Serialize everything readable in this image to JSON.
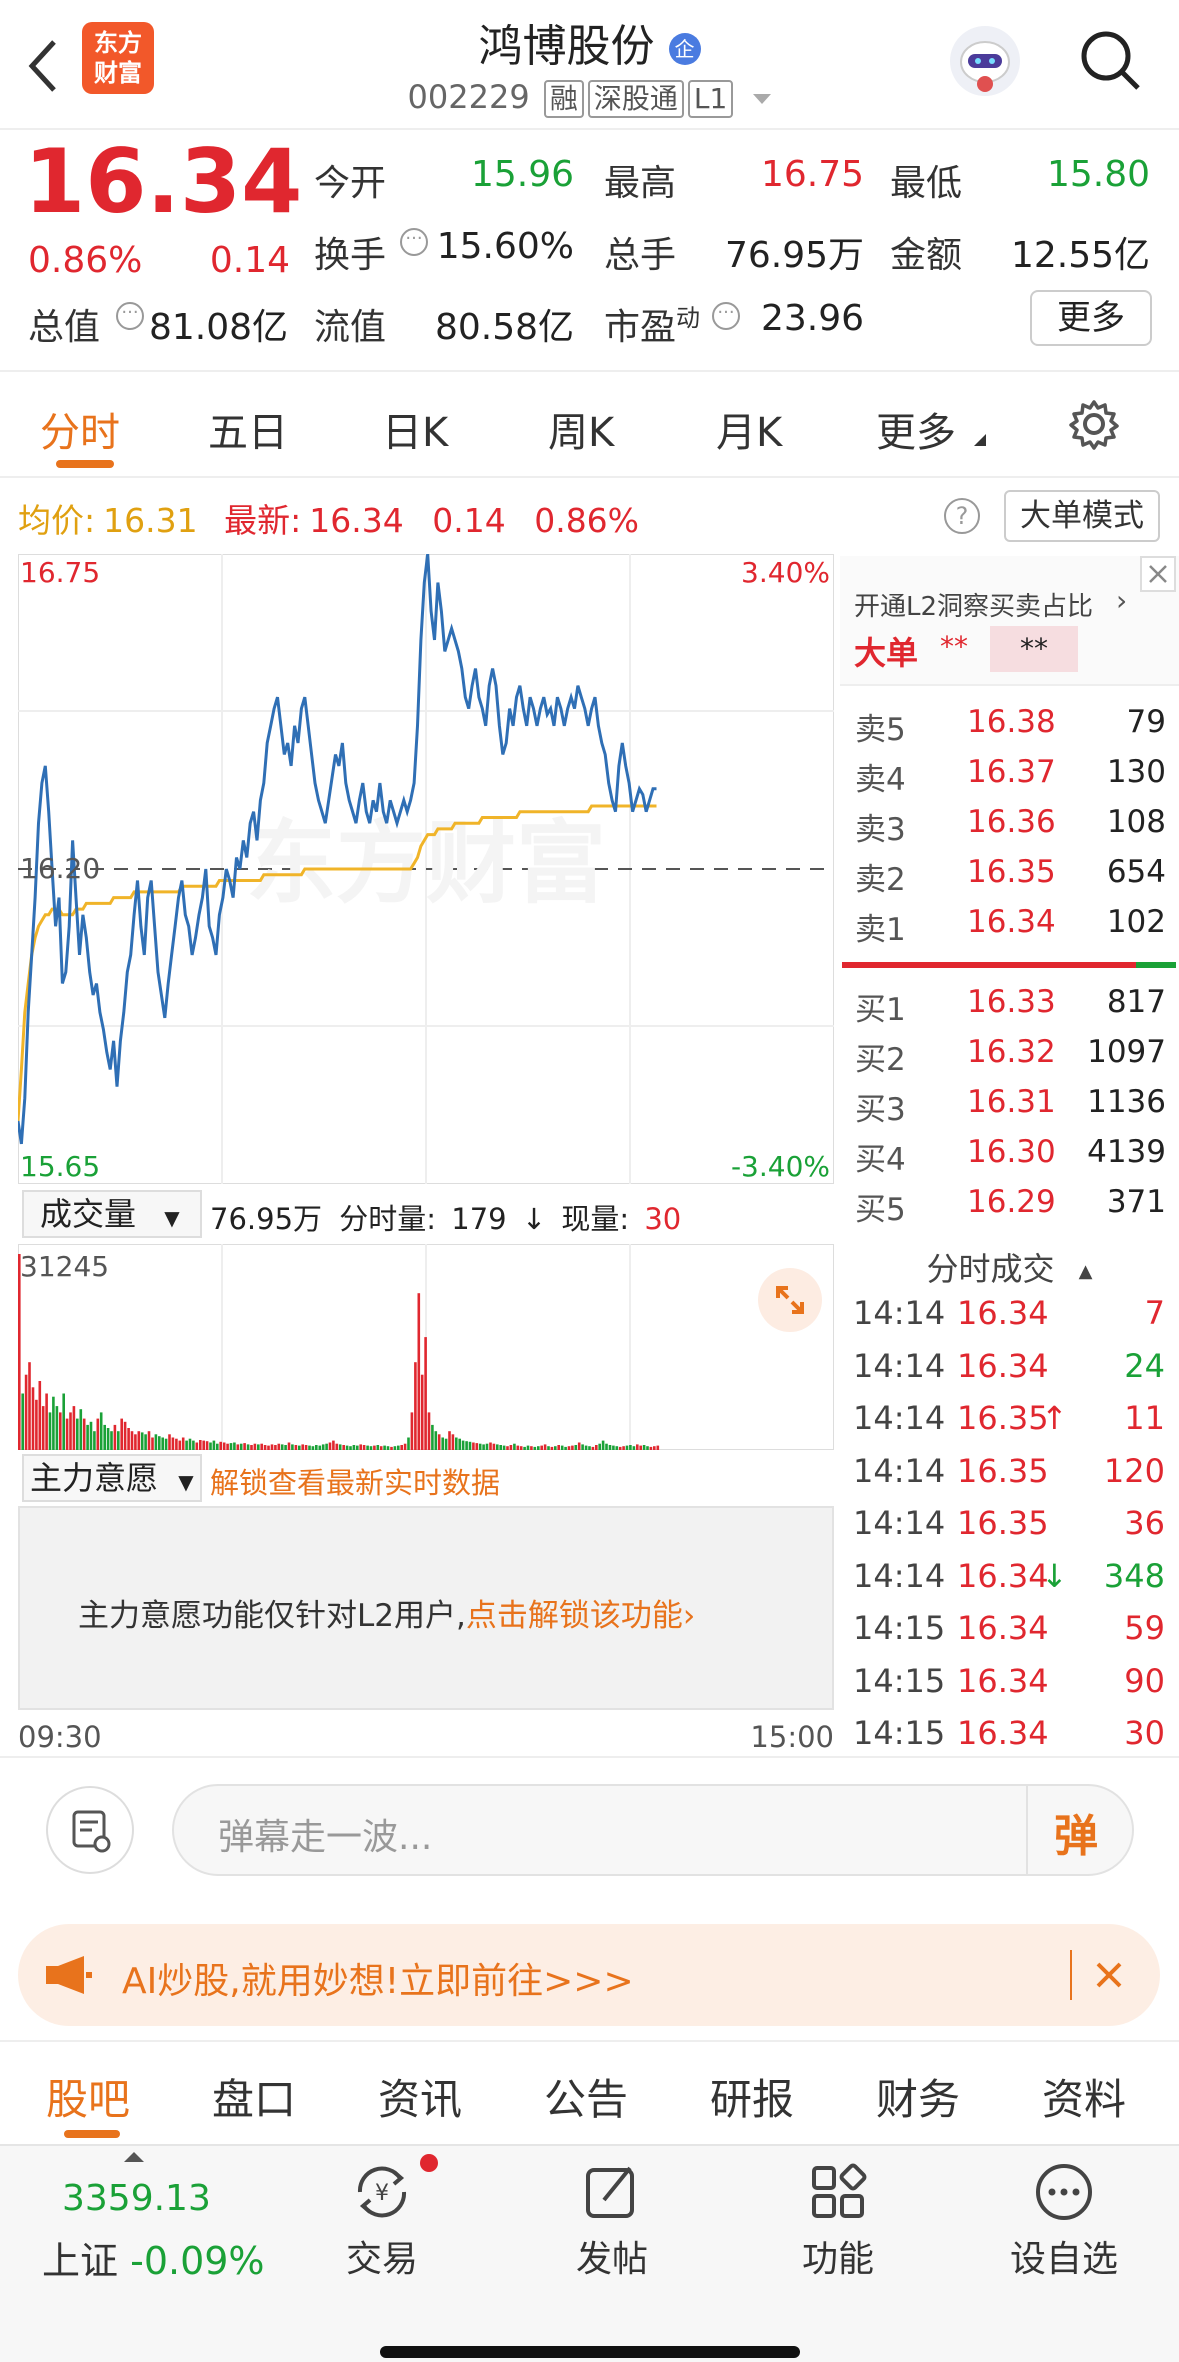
{
  "header": {
    "title": "鸿博股份",
    "code": "002229",
    "tags": [
      "融",
      "深股通",
      "L1"
    ],
    "logo_line1": "东方",
    "logo_line2": "财富",
    "badge": "企"
  },
  "quote": {
    "price": "16.34",
    "pct": "0.86%",
    "chg": "0.14",
    "fields": [
      {
        "label": "今开",
        "value": "15.96",
        "color": "green"
      },
      {
        "label": "最高",
        "value": "16.75",
        "color": "red"
      },
      {
        "label": "最低",
        "value": "15.80",
        "color": "green"
      },
      {
        "label": "换手",
        "value": "15.60%",
        "color": "black"
      },
      {
        "label": "总手",
        "value": "76.95万",
        "color": "black"
      },
      {
        "label": "金额",
        "value": "12.55亿",
        "color": "black"
      },
      {
        "label": "总值",
        "value": "81.08亿",
        "color": "black"
      },
      {
        "label": "流值",
        "value": "80.58亿",
        "color": "black"
      },
      {
        "label": "市盈",
        "sup": "动",
        "value": "23.96",
        "color": "black"
      }
    ],
    "more_btn": "更多"
  },
  "tabs": [
    "分时",
    "五日",
    "日K",
    "周K",
    "月K",
    "更多"
  ],
  "info_bar": {
    "avg_label": "均价:",
    "avg": "16.31",
    "latest_label": "最新:",
    "latest": "16.34",
    "chg": "0.14",
    "pct": "0.86%",
    "mode_btn": "大单模式"
  },
  "chart": {
    "high": "16.75",
    "low": "15.65",
    "mid": "16.20",
    "pct_high": "3.40%",
    "pct_low": "-3.40%",
    "watermark": "东方财富",
    "time_start": "09:30",
    "time_end": "15:00"
  },
  "chart_data": {
    "type": "line",
    "title": "",
    "ylim": [
      15.65,
      16.75
    ],
    "series": [
      {
        "name": "",
        "values": [
          15.76,
          15.72,
          15.8,
          15.95,
          16.05,
          16.15,
          16.28,
          16.35,
          16.38,
          16.3,
          16.2,
          16.1,
          16.15,
          16.0,
          16.02,
          16.1,
          16.25,
          16.15,
          16.05,
          16.12,
          16.08,
          16.02,
          15.98,
          16.0,
          15.95,
          15.92,
          15.88,
          15.85,
          15.9,
          15.82,
          15.9,
          15.95,
          16.02,
          16.05,
          16.12,
          16.18,
          16.1,
          16.05,
          16.15,
          16.18,
          16.1,
          16.02,
          15.98,
          15.94,
          16.0,
          16.05,
          16.1,
          16.15,
          16.18,
          16.12,
          16.1,
          16.05,
          16.08,
          16.12,
          16.15,
          16.2,
          16.1,
          16.08,
          16.05,
          16.12,
          16.15,
          16.2,
          16.18,
          16.15,
          16.22,
          16.2,
          16.25,
          16.22,
          16.28,
          16.3,
          16.25,
          16.32,
          16.35,
          16.42,
          16.45,
          16.48,
          16.5,
          16.45,
          16.4,
          16.42,
          16.38,
          16.45,
          16.42,
          16.48,
          16.5,
          16.45,
          16.4,
          16.35,
          16.32,
          16.3,
          16.28,
          16.32,
          16.36,
          16.4,
          16.38,
          16.42,
          16.35,
          16.32,
          16.3,
          16.28,
          16.32,
          16.35,
          16.3,
          16.28,
          16.32,
          16.3,
          16.35,
          16.3,
          16.28,
          16.32,
          16.3,
          16.28,
          16.3,
          16.32,
          16.3,
          16.32,
          16.35,
          16.45,
          16.6,
          16.7,
          16.75,
          16.65,
          16.6,
          16.7,
          16.65,
          16.58,
          16.6,
          16.62,
          16.6,
          16.58,
          16.55,
          16.5,
          16.48,
          16.52,
          16.55,
          16.5,
          16.48,
          16.45,
          16.52,
          16.55,
          16.52,
          16.45,
          16.4,
          16.42,
          16.48,
          16.45,
          16.5,
          16.52,
          16.48,
          16.45,
          16.5,
          16.48,
          16.45,
          16.48,
          16.5,
          16.47,
          16.48,
          16.45,
          16.5,
          16.48,
          16.45,
          16.48,
          16.5,
          16.48,
          16.52,
          16.5,
          16.48,
          16.45,
          16.48,
          16.5,
          16.45,
          16.42,
          16.4,
          16.35,
          16.32,
          16.3,
          16.38,
          16.42,
          16.38,
          16.35,
          16.3,
          16.32,
          16.34,
          16.33,
          16.3,
          16.32,
          16.34,
          16.34
        ]
      },
      {
        "name": "",
        "values": [
          15.76,
          15.85,
          15.95,
          16.0,
          16.05,
          16.08,
          16.1,
          16.11,
          16.12,
          16.12,
          16.13,
          16.13,
          16.13,
          16.12,
          16.12,
          16.12,
          16.12,
          16.13,
          16.13,
          16.13,
          16.14,
          16.14,
          16.14,
          16.14,
          16.14,
          16.14,
          16.14,
          16.14,
          16.15,
          16.15,
          16.15,
          16.15,
          16.15,
          16.15,
          16.16,
          16.16,
          16.16,
          16.16,
          16.16,
          16.16,
          16.16,
          16.16,
          16.16,
          16.16,
          16.16,
          16.16,
          16.16,
          16.16,
          16.17,
          16.17,
          16.17,
          16.17,
          16.17,
          16.17,
          16.17,
          16.17,
          16.17,
          16.17,
          16.17,
          16.18,
          16.18,
          16.18,
          16.18,
          16.18,
          16.18,
          16.18,
          16.18,
          16.18,
          16.18,
          16.18,
          16.18,
          16.18,
          16.19,
          16.19,
          16.19,
          16.19,
          16.19,
          16.19,
          16.19,
          16.19,
          16.19,
          16.19,
          16.19,
          16.19,
          16.2,
          16.2,
          16.2,
          16.2,
          16.2,
          16.2,
          16.2,
          16.2,
          16.2,
          16.2,
          16.2,
          16.2,
          16.2,
          16.2,
          16.2,
          16.2,
          16.2,
          16.2,
          16.2,
          16.2,
          16.2,
          16.2,
          16.2,
          16.2,
          16.2,
          16.2,
          16.2,
          16.2,
          16.2,
          16.2,
          16.2,
          16.2,
          16.21,
          16.22,
          16.24,
          16.25,
          16.26,
          16.26,
          16.26,
          16.27,
          16.27,
          16.27,
          16.27,
          16.27,
          16.28,
          16.28,
          16.28,
          16.28,
          16.28,
          16.28,
          16.28,
          16.28,
          16.29,
          16.29,
          16.29,
          16.29,
          16.29,
          16.29,
          16.29,
          16.29,
          16.29,
          16.29,
          16.29,
          16.3,
          16.3,
          16.3,
          16.3,
          16.3,
          16.3,
          16.3,
          16.3,
          16.3,
          16.3,
          16.3,
          16.3,
          16.3,
          16.3,
          16.3,
          16.3,
          16.3,
          16.3,
          16.3,
          16.3,
          16.3,
          16.31,
          16.31,
          16.31,
          16.31,
          16.31,
          16.31,
          16.31,
          16.31,
          16.31,
          16.31,
          16.31,
          16.31,
          16.31,
          16.31,
          16.31,
          16.31,
          16.31,
          16.31,
          16.31,
          16.31
        ]
      }
    ],
    "volume": [
      31245,
      9000,
      12000,
      14000,
      10000,
      8000,
      11000,
      7000,
      9000,
      6000,
      8500,
      7000,
      6000,
      9000,
      5000,
      6000,
      7000,
      5000,
      6500,
      5000,
      4000,
      4500,
      3000,
      5000,
      6000,
      4000,
      3500,
      3000,
      4000,
      3000,
      5000,
      4500,
      3500,
      3000,
      2500,
      3000,
      2800,
      2500,
      3000,
      2000,
      2500,
      2200,
      2000,
      1800,
      2500,
      2000,
      1800,
      1500,
      2000,
      1500,
      1800,
      1500,
      1200,
      1600,
      1500,
      1400,
      1200,
      1500,
      1000,
      1300,
      1200,
      1000,
      1100,
      1200,
      900,
      1000,
      1100,
      900,
      800,
      1000,
      900,
      1000,
      800,
      700,
      900,
      800,
      1000,
      900,
      800,
      1200,
      900,
      800,
      700,
      900,
      800,
      700,
      600,
      800,
      700,
      900,
      1000,
      1200,
      1500,
      1000,
      900,
      800,
      700,
      600,
      800,
      700,
      900,
      800,
      700,
      600,
      700,
      800,
      600,
      700,
      600,
      500,
      600,
      700,
      800,
      1000,
      2000,
      6000,
      14000,
      25000,
      12000,
      18000,
      6000,
      4000,
      3000,
      2500,
      2000,
      1800,
      3000,
      2500,
      2000,
      1800,
      1500,
      1400,
      1300,
      1200,
      1100,
      1000,
      900,
      1000,
      1200,
      1000,
      900,
      800,
      700,
      600,
      800,
      1000,
      700,
      600,
      500,
      700,
      600,
      500,
      600,
      700,
      900,
      600,
      500,
      600,
      800,
      700,
      500,
      600,
      700,
      800,
      1200,
      900,
      700,
      600,
      500,
      800,
      1000,
      1500,
      1000,
      800,
      700,
      600,
      500,
      600,
      700,
      800,
      600,
      900,
      700,
      800,
      600,
      500,
      600,
      700
    ]
  },
  "volume_bar": {
    "dropdown": "成交量",
    "total": "76.95万",
    "period_label": "分时量:",
    "period": "179",
    "arrow": "↓",
    "now_label": "现量:",
    "now": "30",
    "max": "31245"
  },
  "main_will": {
    "dropdown": "主力意愿",
    "unlock": "解锁查看最新实时数据",
    "msg": "主力意愿功能仅针对L2用户,",
    "link": "点击解锁该功能"
  },
  "orderbook": {
    "promo": "开通L2洞察买卖占比",
    "big_label": "大单",
    "stars1": "**",
    "stars2": "**",
    "asks": [
      {
        "lbl": "卖5",
        "p": "16.38",
        "v": "79"
      },
      {
        "lbl": "卖4",
        "p": "16.37",
        "v": "130"
      },
      {
        "lbl": "卖3",
        "p": "16.36",
        "v": "108"
      },
      {
        "lbl": "卖2",
        "p": "16.35",
        "v": "654"
      },
      {
        "lbl": "卖1",
        "p": "16.34",
        "v": "102"
      }
    ],
    "bids": [
      {
        "lbl": "买1",
        "p": "16.33",
        "v": "817"
      },
      {
        "lbl": "买2",
        "p": "16.32",
        "v": "1097"
      },
      {
        "lbl": "买3",
        "p": "16.31",
        "v": "1136"
      },
      {
        "lbl": "买4",
        "p": "16.30",
        "v": "4139"
      },
      {
        "lbl": "买5",
        "p": "16.29",
        "v": "371"
      }
    ]
  },
  "trades": {
    "title": "分时成交",
    "rows": [
      {
        "t": "14:14",
        "p": "16.34",
        "a": "",
        "v": "7",
        "c": "red"
      },
      {
        "t": "14:14",
        "p": "16.34",
        "a": "",
        "v": "24",
        "c": "green"
      },
      {
        "t": "14:14",
        "p": "16.35",
        "a": "↑",
        "v": "11",
        "c": "red"
      },
      {
        "t": "14:14",
        "p": "16.35",
        "a": "",
        "v": "120",
        "c": "red"
      },
      {
        "t": "14:14",
        "p": "16.35",
        "a": "",
        "v": "36",
        "c": "red"
      },
      {
        "t": "14:14",
        "p": "16.34",
        "a": "↓",
        "v": "348",
        "c": "green"
      },
      {
        "t": "14:15",
        "p": "16.34",
        "a": "",
        "v": "59",
        "c": "red"
      },
      {
        "t": "14:15",
        "p": "16.34",
        "a": "",
        "v": "90",
        "c": "red"
      },
      {
        "t": "14:15",
        "p": "16.34",
        "a": "",
        "v": "30",
        "c": "red"
      }
    ]
  },
  "comment": {
    "placeholder": "弹幕走一波...",
    "btn": "弹"
  },
  "banner": {
    "text": "AI炒股,就用妙想!立即前往>>>"
  },
  "bottom_tabs": [
    "股吧",
    "盘口",
    "资讯",
    "公告",
    "研报",
    "财务",
    "资料"
  ],
  "nav": {
    "index_value": "3359.13",
    "index_name": "上证",
    "index_pct": "-0.09%",
    "items": [
      "交易",
      "发帖",
      "功能",
      "设自选"
    ]
  }
}
